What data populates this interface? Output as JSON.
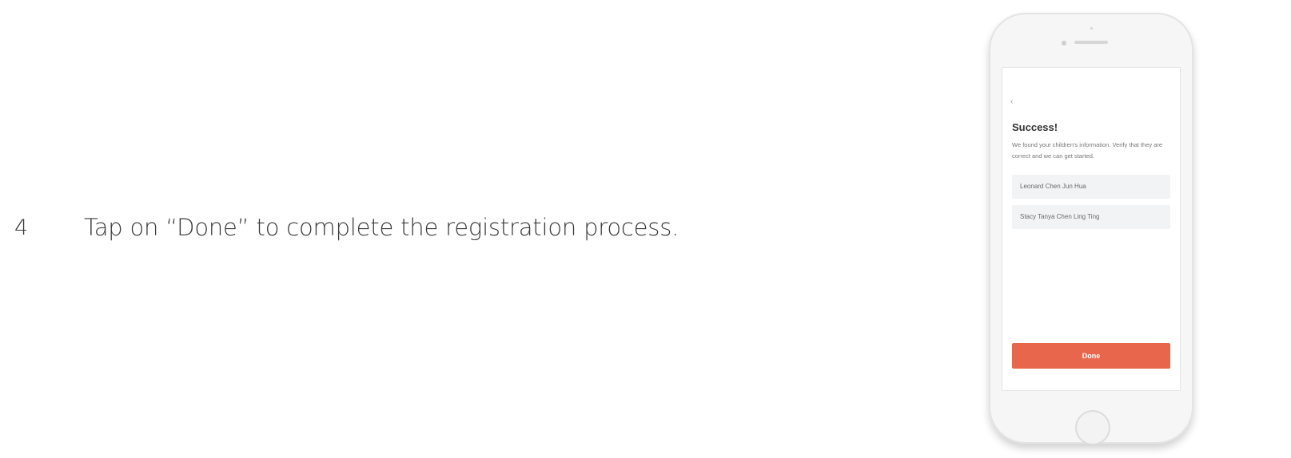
{
  "step": {
    "number": "4",
    "text": "Tap on “Done” to complete the registration process."
  },
  "phone_screen": {
    "back_icon": "‹",
    "title": "Success!",
    "description": "We found your children's information. Verify that they are correct and we can get started.",
    "children": [
      "Leonard Chen Jun Hua",
      "Stacy Tanya Chen Ling Ting"
    ],
    "done_label": "Done"
  },
  "colors": {
    "accent": "#e8674c",
    "field_bg": "#f1f3f5"
  }
}
